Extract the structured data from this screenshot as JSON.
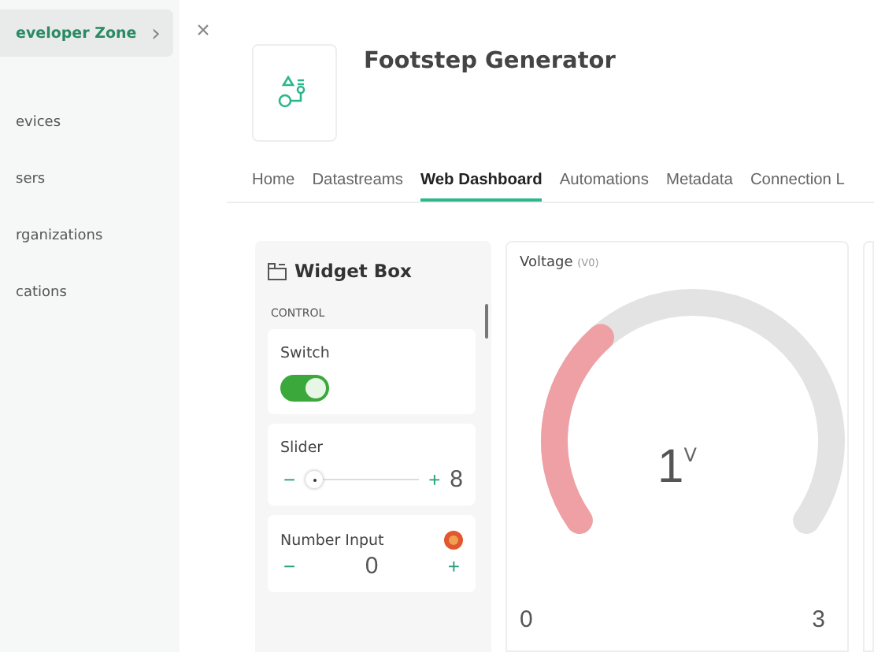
{
  "sidebar": {
    "items": [
      {
        "label": "eveloper Zone",
        "selected": true,
        "chevron": "›"
      },
      {
        "label": "evices",
        "selected": false
      },
      {
        "label": "sers",
        "selected": false
      },
      {
        "label": "rganizations",
        "selected": false
      },
      {
        "label": "cations",
        "selected": false
      }
    ]
  },
  "close": "×",
  "template": {
    "title": "Footstep Generator"
  },
  "tabs": [
    {
      "label": "Home",
      "selected": false
    },
    {
      "label": "Datastreams",
      "selected": false
    },
    {
      "label": "Web Dashboard",
      "selected": true
    },
    {
      "label": "Automations",
      "selected": false
    },
    {
      "label": "Metadata",
      "selected": false
    },
    {
      "label": "Connection L",
      "selected": false
    }
  ],
  "widget_box": {
    "title": "Widget Box",
    "section": "CONTROL",
    "widgets": [
      {
        "kind": "switch",
        "label": "Switch",
        "on": true
      },
      {
        "kind": "slider",
        "label": "Slider",
        "minus": "−",
        "plus": "+",
        "value": "8"
      },
      {
        "kind": "number",
        "label": "Number Input",
        "minus": "−",
        "plus": "+",
        "value": "0"
      }
    ]
  },
  "gauge": {
    "title": "Voltage",
    "pin": "(V0)",
    "value": "1",
    "unit": "V",
    "min": "0",
    "max": "3"
  }
}
